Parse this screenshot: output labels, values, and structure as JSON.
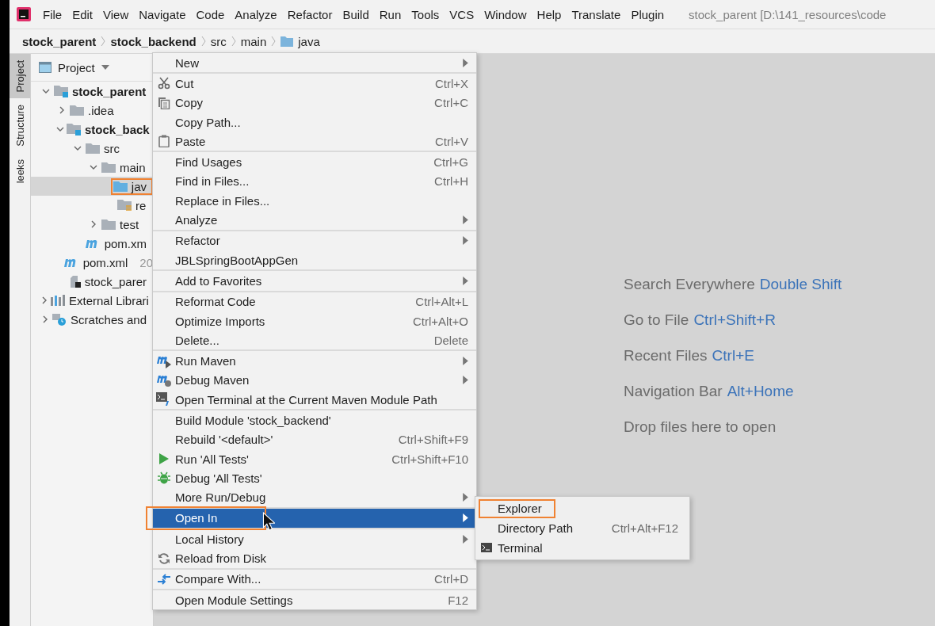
{
  "menu_bar": {
    "items": [
      "File",
      "Edit",
      "View",
      "Navigate",
      "Code",
      "Analyze",
      "Refactor",
      "Build",
      "Run",
      "Tools",
      "VCS",
      "Window",
      "Help",
      "Translate",
      "Plugin"
    ],
    "title": "stock_parent [D:\\141_resources\\code"
  },
  "breadcrumb": [
    {
      "label": "stock_parent",
      "kind": "module"
    },
    {
      "label": "stock_backend",
      "kind": "module"
    },
    {
      "label": "src",
      "kind": "directory"
    },
    {
      "label": "main",
      "kind": "directory"
    },
    {
      "label": "java",
      "kind": "source"
    }
  ],
  "tool_strip": [
    {
      "label": "Project",
      "selected": true
    },
    {
      "label": "Structure",
      "selected": false
    },
    {
      "label": "leeks",
      "selected": false
    }
  ],
  "project_panel": {
    "title": "Project",
    "tree": [
      {
        "label": "stock_parent",
        "kind": "module",
        "bold": true,
        "expanded": true,
        "selected": false,
        "annotated": false,
        "children": [
          {
            "label": ".idea",
            "kind": "folder",
            "bold": false,
            "expanded": false,
            "selected": false,
            "annotated": false
          },
          {
            "label": "stock_back",
            "kind": "module",
            "bold": true,
            "expanded": true,
            "selected": false,
            "annotated": false,
            "children": [
              {
                "label": "src",
                "kind": "folder",
                "bold": false,
                "expanded": true,
                "selected": false,
                "annotated": false,
                "children": [
                  {
                    "label": "main",
                    "kind": "folder",
                    "bold": false,
                    "expanded": true,
                    "selected": false,
                    "annotated": false,
                    "children": [
                      {
                        "label": "jav",
                        "kind": "source",
                        "bold": false,
                        "selected": true,
                        "annotated": true
                      },
                      {
                        "label": "re",
                        "kind": "resources",
                        "bold": false,
                        "selected": false,
                        "annotated": false
                      }
                    ]
                  },
                  {
                    "label": "test",
                    "kind": "folder",
                    "bold": false,
                    "expanded": false,
                    "selected": false,
                    "annotated": false
                  }
                ]
              },
              {
                "label": "pom.xm",
                "kind": "maven",
                "bold": false,
                "selected": false,
                "annotated": false
              }
            ]
          },
          {
            "label": "pom.xml",
            "note": "20",
            "kind": "maven",
            "bold": false,
            "selected": false,
            "annotated": false
          },
          {
            "label": "stock_parer",
            "kind": "file",
            "bold": false,
            "selected": false,
            "annotated": false
          }
        ]
      },
      {
        "label": "External Librari",
        "kind": "libraries",
        "bold": false,
        "expanded": false,
        "selected": false,
        "annotated": false
      },
      {
        "label": "Scratches and",
        "kind": "scratches",
        "bold": false,
        "expanded": false,
        "selected": false,
        "annotated": false
      }
    ]
  },
  "editor_hints": [
    {
      "text": "Search Everywhere",
      "shortcut": "Double Shift"
    },
    {
      "text": "Go to File",
      "shortcut": "Ctrl+Shift+R"
    },
    {
      "text": "Recent Files",
      "shortcut": "Ctrl+E"
    },
    {
      "text": "Navigation Bar",
      "shortcut": "Alt+Home"
    },
    {
      "text": "Drop files here to open"
    }
  ],
  "context_menu": {
    "groups": [
      [
        {
          "label": "New",
          "submenu": true,
          "selected": false,
          "annotated": false
        }
      ],
      [
        {
          "label": "Cut",
          "shortcut": "Ctrl+X",
          "kind": "cut",
          "selected": false,
          "annotated": false
        },
        {
          "label": "Copy",
          "shortcut": "Ctrl+C",
          "kind": "copy",
          "selected": false,
          "annotated": false
        },
        {
          "label": "Copy Path...",
          "selected": false,
          "annotated": false
        },
        {
          "label": "Paste",
          "shortcut": "Ctrl+V",
          "kind": "paste",
          "selected": false,
          "annotated": false
        }
      ],
      [
        {
          "label": "Find Usages",
          "shortcut": "Ctrl+G",
          "selected": false,
          "annotated": false
        },
        {
          "label": "Find in Files...",
          "shortcut": "Ctrl+H",
          "selected": false,
          "annotated": false
        },
        {
          "label": "Replace in Files...",
          "selected": false,
          "annotated": false
        },
        {
          "label": "Analyze",
          "submenu": true,
          "selected": false,
          "annotated": false
        }
      ],
      [
        {
          "label": "Refactor",
          "submenu": true,
          "selected": false,
          "annotated": false
        },
        {
          "label": "JBLSpringBootAppGen",
          "selected": false,
          "annotated": false
        }
      ],
      [
        {
          "label": "Add to Favorites",
          "submenu": true,
          "selected": false,
          "annotated": false
        }
      ],
      [
        {
          "label": "Reformat Code",
          "shortcut": "Ctrl+Alt+L",
          "selected": false,
          "annotated": false
        },
        {
          "label": "Optimize Imports",
          "shortcut": "Ctrl+Alt+O",
          "selected": false,
          "annotated": false
        },
        {
          "label": "Delete...",
          "shortcut": "Delete",
          "selected": false,
          "annotated": false
        }
      ],
      [
        {
          "label": "Run Maven",
          "kind": "maven-run",
          "submenu": true,
          "selected": false,
          "annotated": false
        },
        {
          "label": "Debug Maven",
          "kind": "maven-debug",
          "submenu": true,
          "selected": false,
          "annotated": false
        },
        {
          "label": "Open Terminal at the Current Maven Module Path",
          "kind": "terminal",
          "selected": false,
          "annotated": false
        }
      ],
      [
        {
          "label": "Build Module 'stock_backend'",
          "selected": false,
          "annotated": false
        },
        {
          "label": "Rebuild '<default>'",
          "shortcut": "Ctrl+Shift+F9",
          "selected": false,
          "annotated": false
        },
        {
          "label": "Run 'All Tests'",
          "shortcut": "Ctrl+Shift+F10",
          "kind": "run",
          "selected": false,
          "annotated": false
        },
        {
          "label": "Debug 'All Tests'",
          "kind": "debug",
          "selected": false,
          "annotated": false
        },
        {
          "label": "More Run/Debug",
          "submenu": true,
          "selected": false,
          "annotated": false
        }
      ],
      [
        {
          "label": "Open In",
          "submenu": true,
          "selected": true,
          "annotated": true,
          "items": [
            {
              "label": "Explorer",
              "annotated": true
            },
            {
              "label": "Directory Path",
              "shortcut": "Ctrl+Alt+F12",
              "annotated": false
            },
            {
              "label": "Terminal",
              "kind": "terminal",
              "annotated": false
            }
          ]
        }
      ],
      [
        {
          "label": "Local History",
          "submenu": true,
          "selected": false,
          "annotated": false
        },
        {
          "label": "Reload from Disk",
          "kind": "reload",
          "selected": false,
          "annotated": false
        }
      ],
      [
        {
          "label": "Compare With...",
          "shortcut": "Ctrl+D",
          "kind": "compare",
          "selected": false,
          "annotated": false
        }
      ],
      [
        {
          "label": "Open Module Settings",
          "shortcut": "F12",
          "selected": false,
          "annotated": false
        }
      ]
    ]
  }
}
